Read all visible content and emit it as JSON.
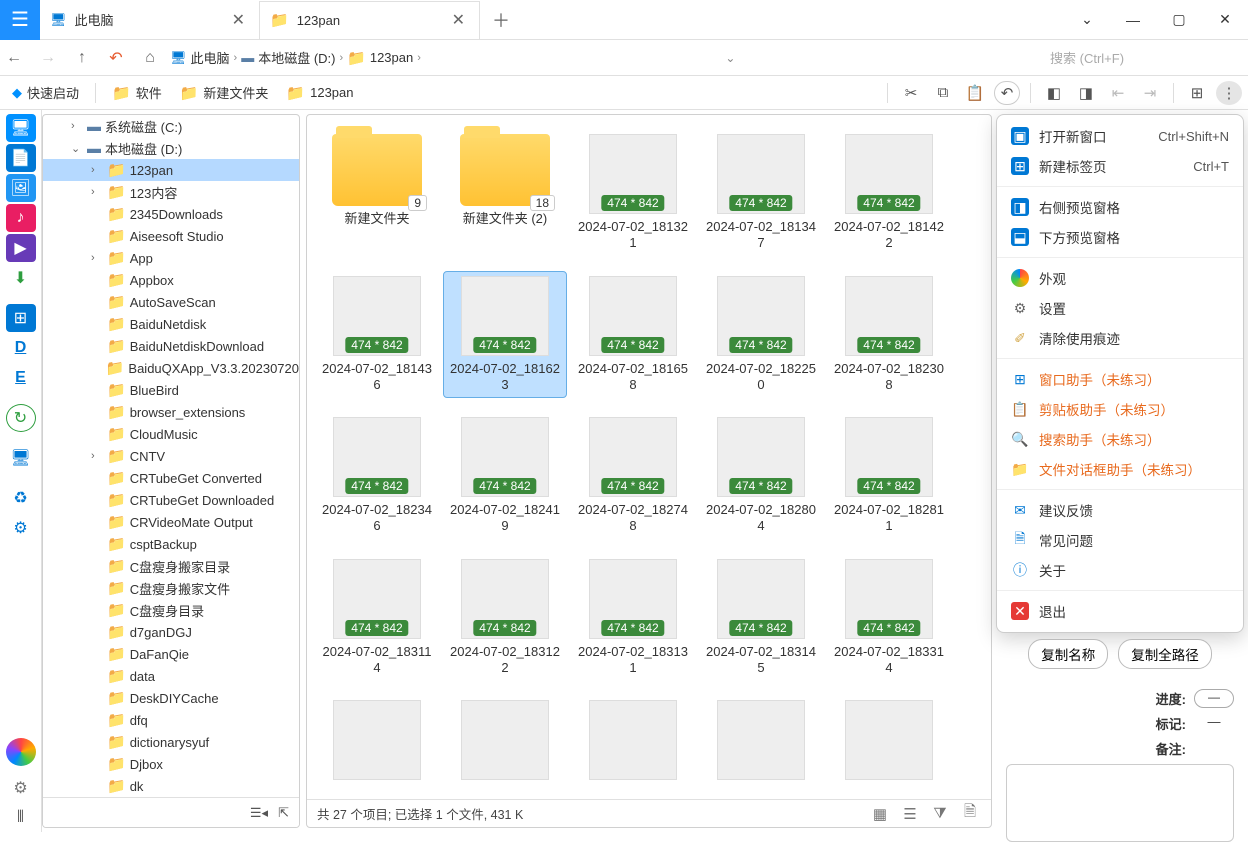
{
  "tabs": [
    {
      "label": "此电脑",
      "icon": "pc"
    },
    {
      "label": "123pan",
      "icon": "folder"
    }
  ],
  "breadcrumb": {
    "items": [
      "此电脑",
      "本地磁盘 (D:)",
      "123pan"
    ]
  },
  "search_placeholder": "搜索 (Ctrl+F)",
  "bookmarks": {
    "quicklaunch": "快速启动",
    "items": [
      "软件",
      "新建文件夹",
      "123pan"
    ]
  },
  "tree": {
    "drives": [
      {
        "label": "系统磁盘 (C:)",
        "expanded": false
      },
      {
        "label": "本地磁盘 (D:)",
        "expanded": true
      }
    ],
    "folders": [
      "123pan",
      "123内容",
      "2345Downloads",
      "Aiseesoft Studio",
      "App",
      "Appbox",
      "AutoSaveScan",
      "BaiduNetdisk",
      "BaiduNetdiskDownload",
      "BaiduQXApp_V3.3.20230720",
      "BlueBird",
      "browser_extensions",
      "CloudMusic",
      "CNTV",
      "CRTubeGet Converted",
      "CRTubeGet Downloaded",
      "CRVideoMate Output",
      "csptBackup",
      "C盘瘦身搬家目录",
      "C盘瘦身搬家文件",
      "C盘瘦身目录",
      "d7ganDGJ",
      "DaFanQie",
      "data",
      "DeskDIYCache",
      "dfq",
      "dictionarysyuf",
      "Djbox",
      "dk"
    ],
    "selected": "123pan",
    "expandable": [
      "123pan",
      "123内容",
      "App",
      "CNTV"
    ]
  },
  "grid": {
    "dim_badge": "474 * 842",
    "folders": [
      {
        "name": "新建文件夹",
        "count": "9"
      },
      {
        "name": "新建文件夹 (2)",
        "count": "18"
      }
    ],
    "images": [
      "2024-07-02_181321",
      "2024-07-02_181347",
      "2024-07-02_181422",
      "2024-07-02_181436",
      "2024-07-02_181623",
      "2024-07-02_181658",
      "2024-07-02_182250",
      "2024-07-02_182308",
      "2024-07-02_182346",
      "2024-07-02_182419",
      "2024-07-02_182748",
      "2024-07-02_182804",
      "2024-07-02_182811",
      "2024-07-02_183114",
      "2024-07-02_183122",
      "2024-07-02_183131",
      "2024-07-02_183145",
      "2024-07-02_183314"
    ],
    "partial_images_count": 5,
    "selected": "2024-07-02_181623"
  },
  "status": "共 27 个项目; 已选择 1 个文件, 431 K",
  "menu": {
    "new_window": "打开新窗口",
    "new_window_key": "Ctrl+Shift+N",
    "new_tab": "新建标签页",
    "new_tab_key": "Ctrl+T",
    "preview_right": "右侧预览窗格",
    "preview_bottom": "下方预览窗格",
    "appearance": "外观",
    "settings": "设置",
    "clear_traces": "清除使用痕迹",
    "window_helper": "窗口助手（未练习）",
    "clipboard_helper": "剪贴板助手（未练习）",
    "search_helper": "搜索助手（未练习）",
    "file_dialog_helper": "文件对话框助手（未练习）",
    "feedback": "建议反馈",
    "faq": "常见问题",
    "about": "关于",
    "exit": "退出"
  },
  "side": {
    "copy_name": "复制名称",
    "copy_path": "复制全路径",
    "progress_label": "进度:",
    "mark_label": "标记:",
    "mark_val": "—",
    "note_label": "备注:"
  }
}
